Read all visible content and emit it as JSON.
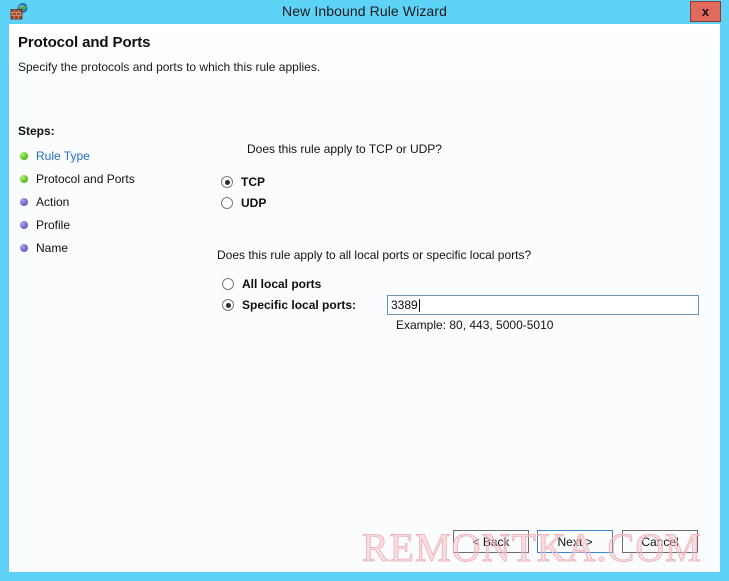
{
  "window": {
    "title": "New Inbound Rule Wizard",
    "app_icon": "firewall-brick-globe-icon",
    "close_label": "x",
    "frame_color": "#5ed2f7",
    "body_color": "#fafcfd"
  },
  "header": {
    "heading": "Protocol and Ports",
    "subheading": "Specify the protocols and ports to which this rule applies."
  },
  "steps": {
    "label": "Steps:",
    "items": [
      {
        "label": "Rule Type",
        "state": "done",
        "is_link": true
      },
      {
        "label": "Protocol and Ports",
        "state": "done",
        "is_link": false
      },
      {
        "label": "Action",
        "state": "pending",
        "is_link": false
      },
      {
        "label": "Profile",
        "state": "pending",
        "is_link": false
      },
      {
        "label": "Name",
        "state": "pending",
        "is_link": false
      }
    ],
    "done_color": "#62c82a",
    "pending_color": "#6f6fd0",
    "link_color": "#1f6fc4"
  },
  "protocol_group": {
    "question": "Does this rule apply to TCP or UDP?",
    "options": [
      {
        "label": "TCP",
        "checked": true
      },
      {
        "label": "UDP",
        "checked": false
      }
    ]
  },
  "ports_group": {
    "question": "Does this rule apply to all local ports or specific local ports?",
    "options": [
      {
        "label": "All local ports",
        "checked": false
      },
      {
        "label": "Specific local ports:",
        "checked": true
      }
    ],
    "input_value": "3389",
    "example_text": "Example: 80, 443, 5000-5010"
  },
  "footer": {
    "back_label": "< Back",
    "next_label": "Next >",
    "cancel_label": "Cancel",
    "focused_button": "next",
    "focus_color": "#3d87cf"
  },
  "watermark": {
    "text": "REMONTKA.COM",
    "color": "#f0b8bd"
  }
}
